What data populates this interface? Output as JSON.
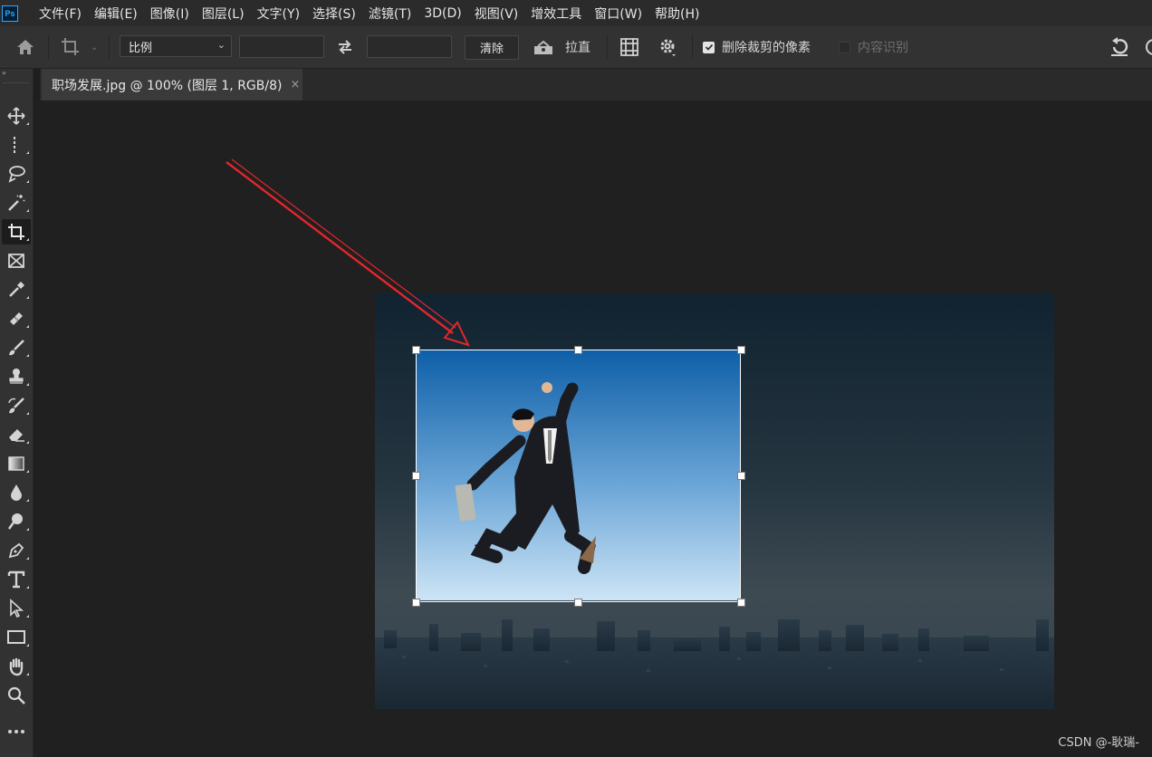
{
  "menu": {
    "logo": "Ps",
    "items": [
      "文件(F)",
      "编辑(E)",
      "图像(I)",
      "图层(L)",
      "文字(Y)",
      "选择(S)",
      "滤镜(T)",
      "3D(D)",
      "视图(V)",
      "增效工具",
      "窗口(W)",
      "帮助(H)"
    ]
  },
  "options": {
    "ratio_value": "比例",
    "width_value": "",
    "height_value": "",
    "clear_label": "清除",
    "straighten_label": "拉直",
    "delete_pixels_label": "删除裁剪的像素",
    "delete_pixels_checked": true,
    "content_aware_label": "内容识别",
    "content_aware_checked": false
  },
  "document_tab": {
    "title": "职场发展.jpg @ 100% (图层 1, RGB/8)",
    "close": "×"
  },
  "tools": [
    "move-tool",
    "marquee-tool",
    "lasso-tool",
    "magic-wand-tool",
    "crop-tool",
    "frame-tool",
    "eyedropper-tool",
    "healing-brush-tool",
    "brush-tool",
    "clone-stamp-tool",
    "history-brush-tool",
    "eraser-tool",
    "gradient-tool",
    "blur-tool",
    "dodge-tool",
    "pen-tool",
    "type-tool",
    "path-selection-tool",
    "rectangle-tool",
    "hand-tool",
    "zoom-tool",
    "more-tools"
  ],
  "active_tool": "crop-tool",
  "colors": {
    "menubar": "#2b2b2b",
    "options_bar": "#323232",
    "workspace": "#202020",
    "annotation_arrow": "#e3262b",
    "sky_top": "#0e5fa8",
    "sky_bottom": "#cfe6f6"
  },
  "watermark": "CSDN @-耿瑞-"
}
